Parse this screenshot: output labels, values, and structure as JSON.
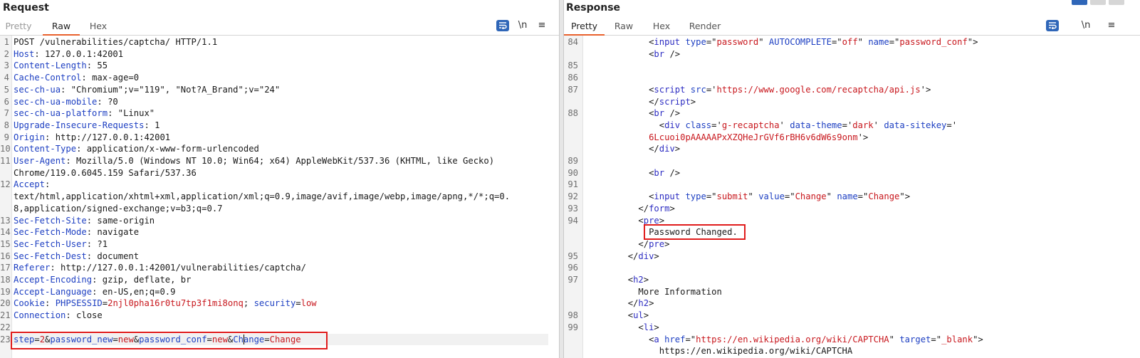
{
  "request": {
    "title": "Request",
    "tabs": [
      {
        "label": "Pretty",
        "state": "disabled"
      },
      {
        "label": "Raw",
        "state": "active"
      },
      {
        "label": "Hex",
        "state": "normal"
      }
    ],
    "newline_toggle": "\\n",
    "lines": [
      {
        "n": "1",
        "parts": [
          [
            "Method",
            "POST /vulnerabilities/captcha/ HTTP/1.1",
            "p"
          ]
        ]
      },
      {
        "n": "2",
        "parts": [
          [
            "k",
            "Host"
          ],
          [
            "p",
            ": 127.0.0.1:42001"
          ]
        ]
      },
      {
        "n": "3",
        "parts": [
          [
            "k",
            "Content-Length"
          ],
          [
            "p",
            ": 55"
          ]
        ]
      },
      {
        "n": "4",
        "parts": [
          [
            "k",
            "Cache-Control"
          ],
          [
            "p",
            ": max-age=0"
          ]
        ]
      },
      {
        "n": "5",
        "parts": [
          [
            "k",
            "sec-ch-ua"
          ],
          [
            "p",
            ": \"Chromium\";v=\"119\", \"Not?A_Brand\";v=\"24\""
          ]
        ]
      },
      {
        "n": "6",
        "parts": [
          [
            "k",
            "sec-ch-ua-mobile"
          ],
          [
            "p",
            ": ?0"
          ]
        ]
      },
      {
        "n": "7",
        "parts": [
          [
            "k",
            "sec-ch-ua-platform"
          ],
          [
            "p",
            ": \"Linux\""
          ]
        ]
      },
      {
        "n": "8",
        "parts": [
          [
            "k",
            "Upgrade-Insecure-Requests"
          ],
          [
            "p",
            ": 1"
          ]
        ]
      },
      {
        "n": "9",
        "parts": [
          [
            "k",
            "Origin"
          ],
          [
            "p",
            ": http://127.0.0.1:42001"
          ]
        ]
      },
      {
        "n": "10",
        "parts": [
          [
            "k",
            "Content-Type"
          ],
          [
            "p",
            ": application/x-www-form-urlencoded"
          ]
        ]
      },
      {
        "n": "11",
        "parts": [
          [
            "k",
            "User-Agent"
          ],
          [
            "p",
            ": Mozilla/5.0 (Windows NT 10.0; Win64; x64) AppleWebKit/537.36 (KHTML, like Gecko)"
          ]
        ]
      },
      {
        "n": "",
        "parts": [
          [
            "p",
            "Chrome/119.0.6045.159 Safari/537.36"
          ]
        ]
      },
      {
        "n": "12",
        "parts": [
          [
            "k",
            "Accept"
          ],
          [
            "p",
            ":"
          ]
        ]
      },
      {
        "n": "",
        "parts": [
          [
            "p",
            "text/html,application/xhtml+xml,application/xml;q=0.9,image/avif,image/webp,image/apng,*/*;q=0."
          ]
        ]
      },
      {
        "n": "",
        "parts": [
          [
            "p",
            "8,application/signed-exchange;v=b3;q=0.7"
          ]
        ]
      },
      {
        "n": "13",
        "parts": [
          [
            "k",
            "Sec-Fetch-Site"
          ],
          [
            "p",
            ": same-origin"
          ]
        ]
      },
      {
        "n": "14",
        "parts": [
          [
            "k",
            "Sec-Fetch-Mode"
          ],
          [
            "p",
            ": navigate"
          ]
        ]
      },
      {
        "n": "15",
        "parts": [
          [
            "k",
            "Sec-Fetch-User"
          ],
          [
            "p",
            ": ?1"
          ]
        ]
      },
      {
        "n": "16",
        "parts": [
          [
            "k",
            "Sec-Fetch-Dest"
          ],
          [
            "p",
            ": document"
          ]
        ]
      },
      {
        "n": "17",
        "parts": [
          [
            "k",
            "Referer"
          ],
          [
            "p",
            ": http://127.0.0.1:42001/vulnerabilities/captcha/"
          ]
        ]
      },
      {
        "n": "18",
        "parts": [
          [
            "k",
            "Accept-Encoding"
          ],
          [
            "p",
            ": gzip, deflate, br"
          ]
        ]
      },
      {
        "n": "19",
        "parts": [
          [
            "k",
            "Accept-Language"
          ],
          [
            "p",
            ": en-US,en;q=0.9"
          ]
        ]
      },
      {
        "n": "20",
        "parts": [
          [
            "k",
            "Cookie"
          ],
          [
            "p",
            ": "
          ],
          [
            "k",
            "PHPSESSID"
          ],
          [
            "p",
            "="
          ],
          [
            "v",
            "2njl0pha16r0tu7tp3f1mi8onq"
          ],
          [
            "p",
            "; "
          ],
          [
            "k",
            "security"
          ],
          [
            "p",
            "="
          ],
          [
            "v",
            "low"
          ]
        ]
      },
      {
        "n": "21",
        "parts": [
          [
            "k",
            "Connection"
          ],
          [
            "p",
            ": close"
          ]
        ]
      },
      {
        "n": "22",
        "parts": []
      },
      {
        "n": "23",
        "parts": [
          [
            "k",
            "step"
          ],
          [
            "p",
            "="
          ],
          [
            "v",
            "2"
          ],
          [
            "p",
            "&"
          ],
          [
            "k",
            "password_new"
          ],
          [
            "p",
            "="
          ],
          [
            "v",
            "new"
          ],
          [
            "p",
            "&"
          ],
          [
            "k",
            "password_conf"
          ],
          [
            "p",
            "="
          ],
          [
            "v",
            "new"
          ],
          [
            "p",
            "&"
          ],
          [
            "k",
            "Change"
          ],
          [
            "p",
            "="
          ],
          [
            "v",
            "Change"
          ]
        ]
      }
    ]
  },
  "response": {
    "title": "Response",
    "tabs": [
      {
        "label": "Pretty",
        "state": "active"
      },
      {
        "label": "Raw",
        "state": "normal"
      },
      {
        "label": "Hex",
        "state": "normal"
      },
      {
        "label": "Render",
        "state": "normal"
      }
    ],
    "newline_toggle": "\\n",
    "lines": [
      {
        "n": "84",
        "indent": 6,
        "parts": [
          [
            "p",
            "<"
          ],
          [
            "t",
            "input"
          ],
          [
            "p",
            " "
          ],
          [
            "k",
            "type"
          ],
          [
            "p",
            "=\""
          ],
          [
            "v",
            "password"
          ],
          [
            "p",
            "\" "
          ],
          [
            "k",
            "AUTOCOMPLETE"
          ],
          [
            "p",
            "=\""
          ],
          [
            "v",
            "off"
          ],
          [
            "p",
            "\" "
          ],
          [
            "k",
            "name"
          ],
          [
            "p",
            "=\""
          ],
          [
            "v",
            "password_conf"
          ],
          [
            "p",
            "\">"
          ]
        ]
      },
      {
        "n": "",
        "indent": 6,
        "parts": [
          [
            "p",
            "<"
          ],
          [
            "t",
            "br"
          ],
          [
            "p",
            " />"
          ]
        ]
      },
      {
        "n": "85",
        "indent": 0,
        "parts": []
      },
      {
        "n": "86",
        "indent": 0,
        "parts": []
      },
      {
        "n": "87",
        "indent": 6,
        "parts": [
          [
            "p",
            "<"
          ],
          [
            "t",
            "script"
          ],
          [
            "p",
            " "
          ],
          [
            "k",
            "src"
          ],
          [
            "p",
            "='"
          ],
          [
            "v",
            "https://www.google.com/recaptcha/api.js"
          ],
          [
            "p",
            "'>"
          ]
        ]
      },
      {
        "n": "",
        "indent": 6,
        "parts": [
          [
            "p",
            "</"
          ],
          [
            "t",
            "script"
          ],
          [
            "p",
            ">"
          ]
        ]
      },
      {
        "n": "88",
        "indent": 6,
        "parts": [
          [
            "p",
            "<"
          ],
          [
            "t",
            "br"
          ],
          [
            "p",
            " />"
          ]
        ]
      },
      {
        "n": "",
        "indent": 7,
        "parts": [
          [
            "p",
            "<"
          ],
          [
            "t",
            "div"
          ],
          [
            "p",
            " "
          ],
          [
            "k",
            "class"
          ],
          [
            "p",
            "='"
          ],
          [
            "v",
            "g-recaptcha"
          ],
          [
            "p",
            "' "
          ],
          [
            "k",
            "data-theme"
          ],
          [
            "p",
            "='"
          ],
          [
            "v",
            "dark"
          ],
          [
            "p",
            "' "
          ],
          [
            "k",
            "data-sitekey"
          ],
          [
            "p",
            "='"
          ]
        ]
      },
      {
        "n": "",
        "indent": 6,
        "parts": [
          [
            "v",
            "6Lcuoi0pAAAAAPxXZQHeJrGVf6rBH6v6dW6s9onm"
          ],
          [
            "p",
            "'>"
          ]
        ]
      },
      {
        "n": "",
        "indent": 6,
        "parts": [
          [
            "p",
            "</"
          ],
          [
            "t",
            "div"
          ],
          [
            "p",
            ">"
          ]
        ]
      },
      {
        "n": "89",
        "indent": 0,
        "parts": []
      },
      {
        "n": "90",
        "indent": 6,
        "parts": [
          [
            "p",
            "<"
          ],
          [
            "t",
            "br"
          ],
          [
            "p",
            " />"
          ]
        ]
      },
      {
        "n": "91",
        "indent": 0,
        "parts": []
      },
      {
        "n": "92",
        "indent": 6,
        "parts": [
          [
            "p",
            "<"
          ],
          [
            "t",
            "input"
          ],
          [
            "p",
            " "
          ],
          [
            "k",
            "type"
          ],
          [
            "p",
            "=\""
          ],
          [
            "v",
            "submit"
          ],
          [
            "p",
            "\" "
          ],
          [
            "k",
            "value"
          ],
          [
            "p",
            "=\""
          ],
          [
            "v",
            "Change"
          ],
          [
            "p",
            "\" "
          ],
          [
            "k",
            "name"
          ],
          [
            "p",
            "=\""
          ],
          [
            "v",
            "Change"
          ],
          [
            "p",
            "\">"
          ]
        ]
      },
      {
        "n": "93",
        "indent": 5,
        "parts": [
          [
            "p",
            "</"
          ],
          [
            "t",
            "form"
          ],
          [
            "p",
            ">"
          ]
        ]
      },
      {
        "n": "94",
        "indent": 5,
        "parts": [
          [
            "p",
            "<"
          ],
          [
            "t",
            "pre"
          ],
          [
            "p",
            ">"
          ]
        ]
      },
      {
        "n": "",
        "indent": 6,
        "parts": [
          [
            "p",
            "Password Changed."
          ]
        ]
      },
      {
        "n": "",
        "indent": 5,
        "parts": [
          [
            "p",
            "</"
          ],
          [
            "t",
            "pre"
          ],
          [
            "p",
            ">"
          ]
        ]
      },
      {
        "n": "95",
        "indent": 4,
        "parts": [
          [
            "p",
            "</"
          ],
          [
            "t",
            "div"
          ],
          [
            "p",
            ">"
          ]
        ]
      },
      {
        "n": "96",
        "indent": 0,
        "parts": []
      },
      {
        "n": "97",
        "indent": 4,
        "parts": [
          [
            "p",
            "<"
          ],
          [
            "t",
            "h2"
          ],
          [
            "p",
            ">"
          ]
        ]
      },
      {
        "n": "",
        "indent": 5,
        "parts": [
          [
            "p",
            "More Information"
          ]
        ]
      },
      {
        "n": "",
        "indent": 4,
        "parts": [
          [
            "p",
            "</"
          ],
          [
            "t",
            "h2"
          ],
          [
            "p",
            ">"
          ]
        ]
      },
      {
        "n": "98",
        "indent": 4,
        "parts": [
          [
            "p",
            "<"
          ],
          [
            "t",
            "ul"
          ],
          [
            "p",
            ">"
          ]
        ]
      },
      {
        "n": "99",
        "indent": 5,
        "parts": [
          [
            "p",
            "<"
          ],
          [
            "t",
            "li"
          ],
          [
            "p",
            ">"
          ]
        ]
      },
      {
        "n": "",
        "indent": 6,
        "parts": [
          [
            "p",
            "<"
          ],
          [
            "t",
            "a"
          ],
          [
            "p",
            " "
          ],
          [
            "k",
            "href"
          ],
          [
            "p",
            "=\""
          ],
          [
            "v",
            "https://en.wikipedia.org/wiki/CAPTCHA"
          ],
          [
            "p",
            "\" "
          ],
          [
            "k",
            "target"
          ],
          [
            "p",
            "=\""
          ],
          [
            "v",
            "_blank"
          ],
          [
            "p",
            "\">"
          ]
        ]
      },
      {
        "n": "",
        "indent": 7,
        "parts": [
          [
            "p",
            "https://en.wikipedia.org/wiki/CAPTCHA"
          ]
        ]
      }
    ]
  },
  "colors": {
    "key": "#1d3fc2",
    "value": "#c8181e",
    "tag": "#2d2dc2",
    "highlight": "#e01c1c",
    "active_tab": "#e8612c",
    "wrap_button": "#2f66b8"
  },
  "icons": {
    "wrap": "wrap-lines-icon",
    "menu": "hamburger-menu-icon",
    "layout": "layout-toggle-icon"
  },
  "menu_glyph": "≡"
}
